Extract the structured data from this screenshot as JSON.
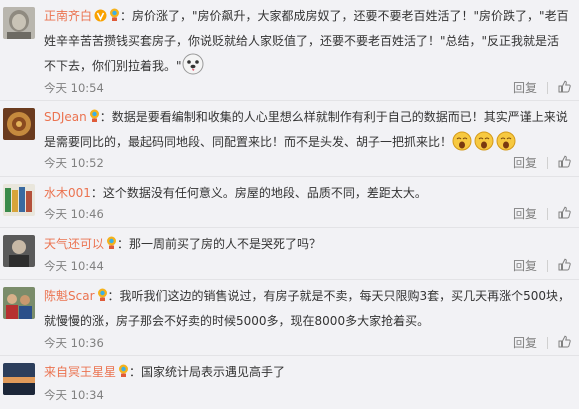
{
  "comments": [
    {
      "user": "正南齐白",
      "text": "：房价涨了，\"房价飙升，大家都成房奴了，还要不要老百姓活了！\"房价跌了，\"老百姓辛辛苦苦攒钱买套房子，你说贬就给人家贬值了，还要不要老百姓活了！\"总结，\"反正我就是活不下去，你们别拉着我。\"",
      "time": "今天 10:54",
      "reply": "回复"
    },
    {
      "user": "SDJean",
      "text": "：数据是要看编制和收集的人心里想么样就制作有利于自己的数据而已！其实严谨上来说是需要同比的，最起码同地段、同配置来比！而不是头发、胡子一把抓来比！",
      "time": "今天 10:52",
      "reply": "回复"
    },
    {
      "user": "水木001",
      "text": "：这个数据没有任何意义。房屋的地段、品质不同，差距太大。",
      "time": "今天 10:46",
      "reply": "回复"
    },
    {
      "user": "天气还可以",
      "text": "：那一周前买了房的人不是哭死了吗？",
      "time": "今天 10:44",
      "reply": "回复"
    },
    {
      "user": "陈魁Scar",
      "text": "：我听我们这边的销售说过，有房子就是不卖，每天只限购3套，买几天再涨个500块，就慢慢的涨，房子那会不好卖的时候5000多，现在8000多大家抢着买。",
      "time": "今天 10:36",
      "reply": "回复"
    },
    {
      "user": "来自冥王星星",
      "text": "：国家统计局表示遇见高手了",
      "time": "今天 10:34",
      "reply": "回复"
    }
  ]
}
